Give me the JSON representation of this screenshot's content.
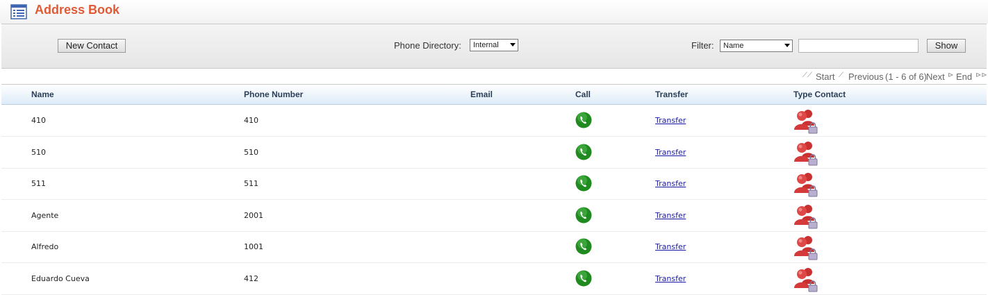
{
  "header": {
    "title": "Address Book",
    "icon": "address-book-icon",
    "title_color": "#e05a35"
  },
  "toolbar": {
    "new_contact_label": "New Contact",
    "phone_directory_label": "Phone Directory:",
    "phone_directory_value": "Internal",
    "filter_label": "Filter:",
    "filter_value": "Name",
    "filter_text": "",
    "show_label": "Show"
  },
  "pager": {
    "start_label": "Start",
    "previous_label": "Previous",
    "range_text": "(1 - 6 of 6)",
    "next_label": "Next",
    "end_label": "End"
  },
  "table": {
    "columns": {
      "name": "Name",
      "phone": "Phone Number",
      "email": "Email",
      "call": "Call",
      "transfer": "Transfer",
      "type": "Type Contact"
    },
    "rows": [
      {
        "name": "410",
        "phone": "410",
        "email": "",
        "transfer": "Transfer"
      },
      {
        "name": "510",
        "phone": "510",
        "email": "",
        "transfer": "Transfer"
      },
      {
        "name": "511",
        "phone": "511",
        "email": "",
        "transfer": "Transfer"
      },
      {
        "name": "Agente",
        "phone": "2001",
        "email": "",
        "transfer": "Transfer"
      },
      {
        "name": "Alfredo",
        "phone": "1001",
        "email": "",
        "transfer": "Transfer"
      },
      {
        "name": "Eduardo Cueva",
        "phone": "412",
        "email": "",
        "transfer": "Transfer"
      }
    ]
  },
  "colors": {
    "header_gradient_bottom": "#ddebf8",
    "link": "#1a1aa6",
    "call_green": "#1f8a1f",
    "contact_red": "#d43a3a"
  }
}
